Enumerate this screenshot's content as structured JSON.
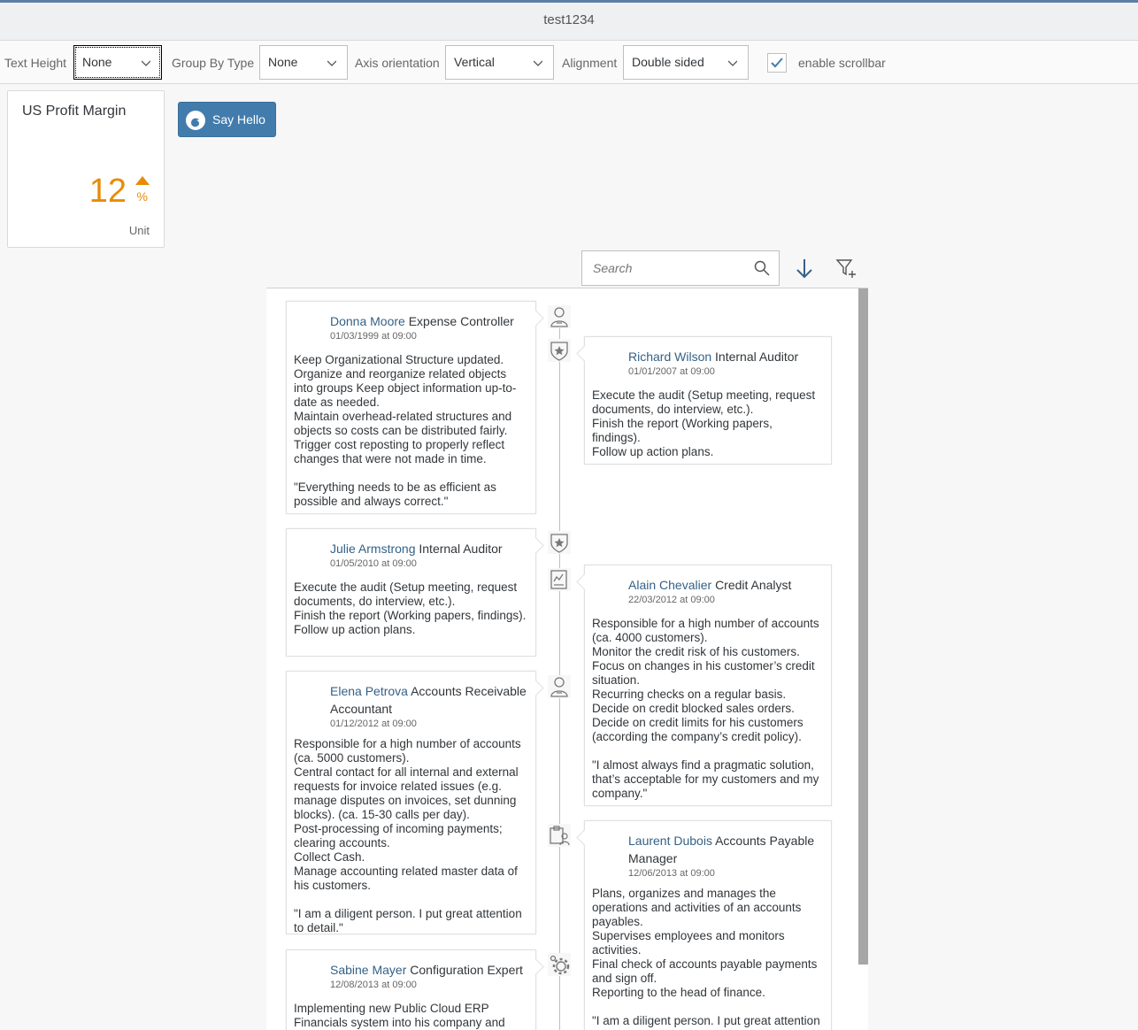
{
  "window": {
    "title": "test1234"
  },
  "toolbar": {
    "text_height": {
      "label": "Text Height",
      "value": "None"
    },
    "group_by_type": {
      "label": "Group By Type",
      "value": "None"
    },
    "axis_orientation": {
      "label": "Axis orientation",
      "value": "Vertical"
    },
    "alignment": {
      "label": "Alignment",
      "value": "Double sided"
    },
    "enable_scrollbar": {
      "label": "enable scrollbar",
      "checked": true
    }
  },
  "tile": {
    "title": "US Profit Margin",
    "value": "12",
    "unit_symbol": "%",
    "trend": "up",
    "unit": "Unit",
    "value_color": "#e78c07"
  },
  "say_hello_button": {
    "label": "Say Hello"
  },
  "timeline_toolbar": {
    "search_placeholder": "Search",
    "sort_icon": "arrow-down-icon",
    "filter_icon": "add-filter-icon"
  },
  "timeline": {
    "items": [
      {
        "name": "Donna Moore",
        "role": "Expense Controller",
        "date": "01/03/1999 at 09:00",
        "icon": "employee-icon",
        "text": "Keep Organizational Structure updated.\nOrganize and reorganize related objects into groups Keep object information up-to-date as needed.\nMaintain overhead-related structures and objects so costs can be distributed fairly.\nTrigger cost reposting to properly reflect changes that were not made in time.\n\n\"Everything needs to be as efficient as possible and always correct.\""
      },
      {
        "name": "Richard Wilson",
        "role": "Internal Auditor",
        "date": "01/01/2007 at 09:00",
        "icon": "badge-icon",
        "text": "Execute the audit (Setup meeting, request documents, do interview, etc.).\nFinish the report (Working papers, findings).\nFollow up action plans."
      },
      {
        "name": "Julie Armstrong",
        "role": "Internal Auditor",
        "date": "01/05/2010 at 09:00",
        "icon": "badge-icon",
        "text": "Execute the audit (Setup meeting, request documents, do interview, etc.).\nFinish the report (Working papers, findings).\nFollow up action plans."
      },
      {
        "name": "Alain Chevalier",
        "role": "Credit Analyst",
        "date": "22/03/2012 at 09:00",
        "icon": "report-icon",
        "text": "Responsible for a high number of accounts (ca. 4000 customers).\nMonitor the credit risk of his customers.\nFocus on changes in his customer’s credit situation.\nRecurring checks on a regular basis.\nDecide on credit blocked sales orders.\nDecide on credit limits for his customers (according the company’s credit policy).\n\n\"I almost always find a pragmatic solution, that’s acceptable for my customers and my company.\""
      },
      {
        "name": "Elena Petrova",
        "role": "Accounts Receivable Accountant",
        "date": "01/12/2012 at 09:00",
        "icon": "employee-icon",
        "text": "Responsible for a high number of accounts (ca. 5000 customers).\nCentral contact for all internal and external requests for invoice related issues (e.g. manage disputes on invoices, set dunning blocks). (ca. 15-30 calls per day).\nPost-processing of incoming payments; clearing accounts.\nCollect Cash.\nManage accounting related master data of his customers.\n\n\"I am a diligent person. I put great attention to detail.\""
      },
      {
        "name": "Laurent Dubois",
        "role": "Accounts Payable Manager",
        "date": "12/06/2013 at 09:00",
        "icon": "manager-icon",
        "text": "Plans, organizes and manages the operations and activities of an accounts payables.\nSupervises employees and monitors activities.\nFinal check of accounts payable payments and sign off.\nReporting to the head of finance.\n\n\"I am a diligent person. I put great attention to detail.\""
      },
      {
        "name": "Sabine Mayer",
        "role": "Configuration Expert",
        "date": "12/08/2013 at 09:00",
        "icon": "settings-icon",
        "text": "Implementing new Public Cloud ERP Financials system into his company and"
      }
    ]
  }
}
